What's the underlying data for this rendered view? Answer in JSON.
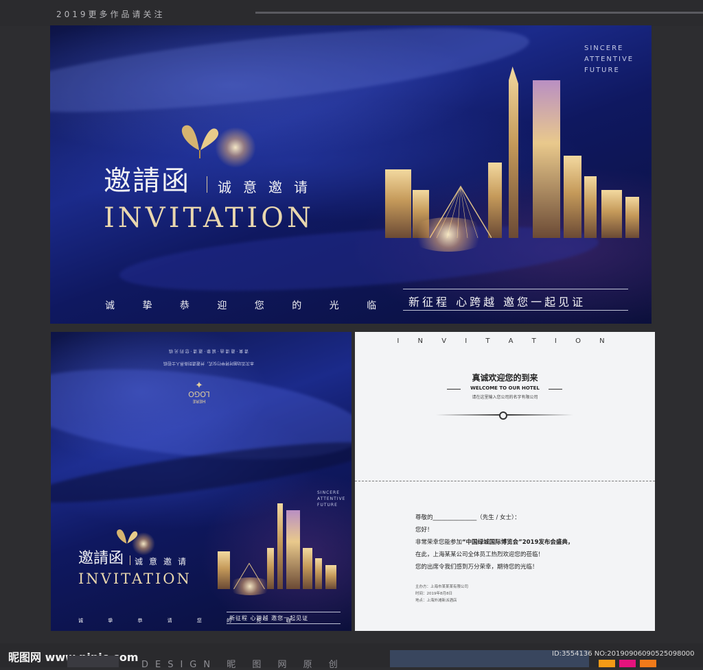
{
  "header": {
    "caption": "2019更多作品请关注"
  },
  "card_top": {
    "sincere": [
      "SINCERE",
      "ATTENTIVE",
      "FUTURE"
    ],
    "title_cn": "邀請函",
    "subtitle_cn": "诚意邀请",
    "title_en": "INVITATION",
    "tagline": "诚 挚 恭 迎 您 的 光 临",
    "slogan": "新征程 心跨越 邀您一起见证"
  },
  "card_left": {
    "mirror_lines": [
      "本次活动届时将举行仪式，并邀请到各界人士莅临",
      "请 柬 · 邀 请 函 · 诚 挚 · 邀 请 · 您 的 光 临"
    ],
    "logo": "LOGO",
    "logo_sub": "HERE",
    "sincere": [
      "SINCERE",
      "ATTENTIVE",
      "FUTURE"
    ],
    "title_cn": "邀請函",
    "subtitle_cn": "诚意邀请",
    "title_en": "INVITATION",
    "tagline": "诚 挚 恭 请 您 的 光 临",
    "slogan": "新征程 心跨越 邀您一起见证"
  },
  "card_right": {
    "header": "I N V I T A T I O N",
    "welcome_cn": "真诚欢迎您的到来",
    "welcome_en": "WELCOME TO OUR HOTEL",
    "welcome_sub": "请在这里输入您公司的名字有限公司",
    "greeting": "尊敬的_______________（先生 / 女士）：",
    "hello": "您好！",
    "line1_pre": "非常荣幸您能参加",
    "line1_event": "“中国绿城国际博览会”",
    "line1_post": "2019发布会盛典，",
    "line2": "在此，上海某某公司全体员工热烈欢迎您的莅临！",
    "line3": "您的出席令我们感到万分荣幸，期待您的光临！",
    "meta": [
      "主办方：上海市某某某有限公司",
      "时间：2019年8月8日",
      "地点：上海外滩新派酒店"
    ]
  },
  "footer": {
    "watermark": "昵图网 www.nipic.com",
    "design": "DESIGN 昵 图 网 原 创",
    "id": "ID:3554136 NO:20190906090525098000"
  }
}
